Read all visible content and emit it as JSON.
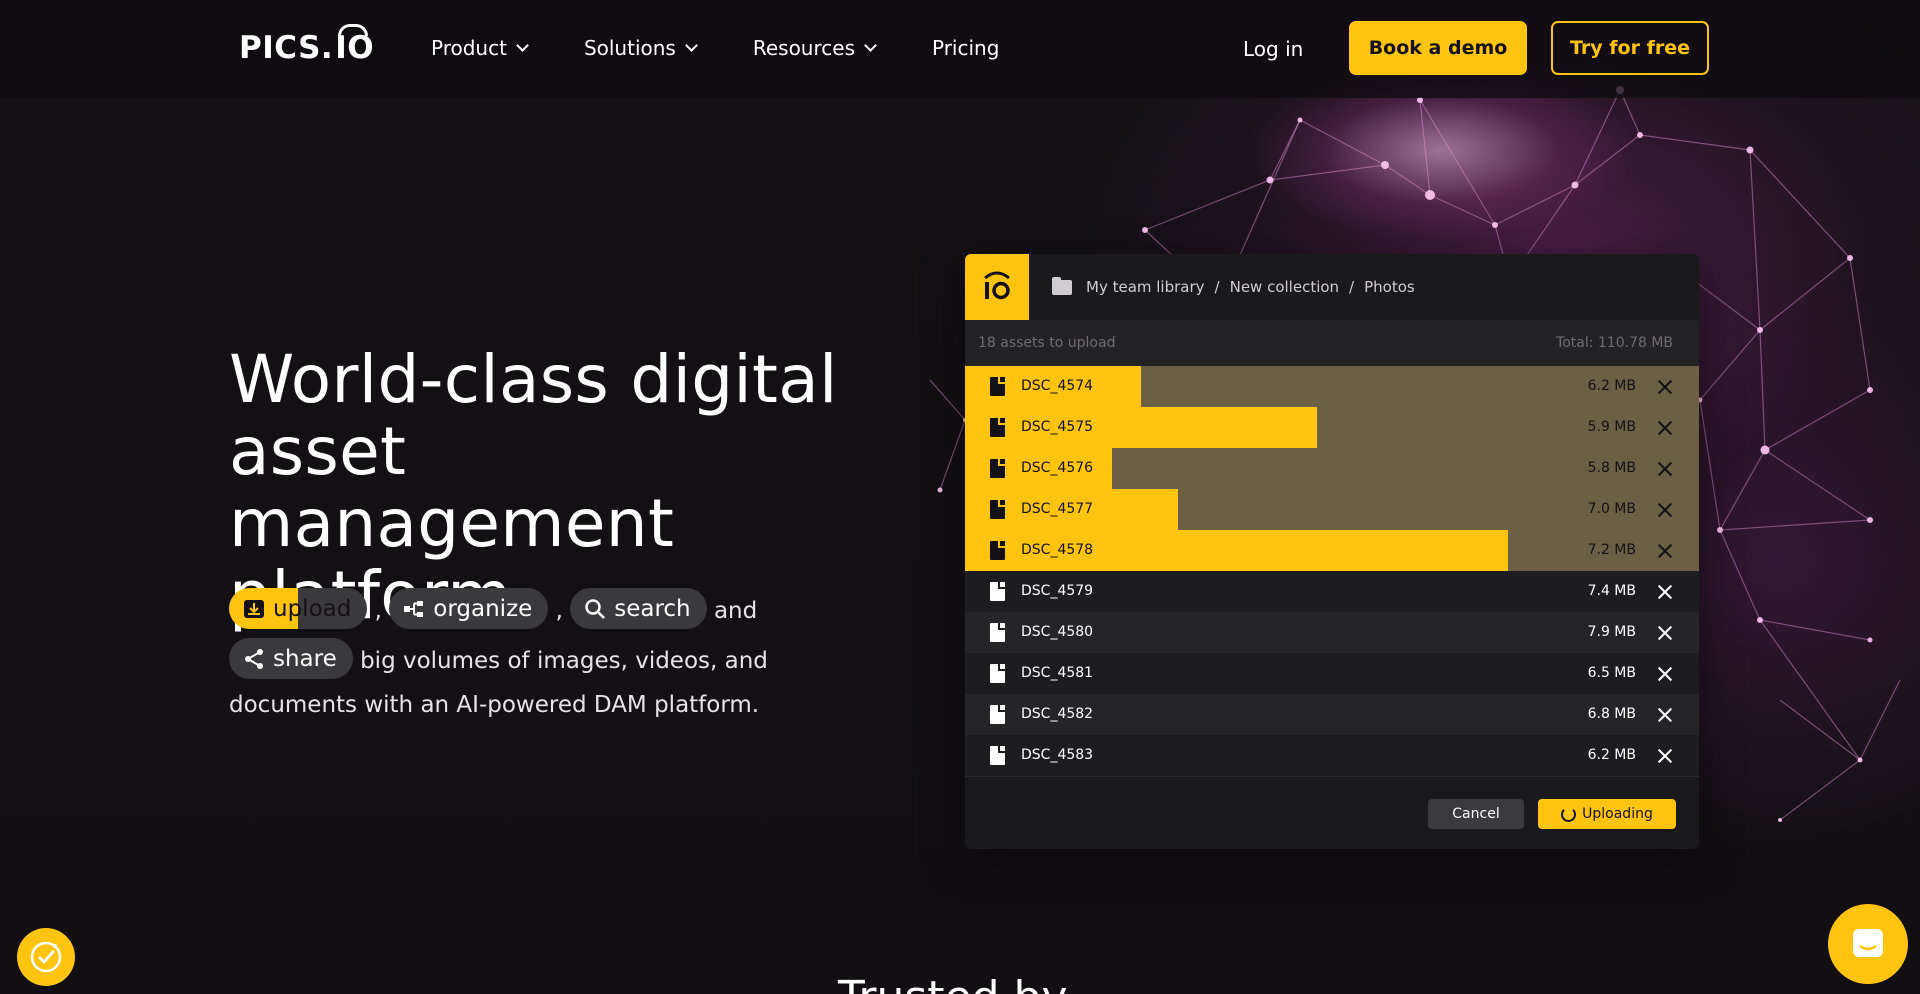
{
  "nav": {
    "logo_text": "PICS.IO",
    "logo_prefix": "PICS.",
    "logo_suffix": "IO",
    "items": [
      {
        "label": "Product",
        "has_dropdown": true
      },
      {
        "label": "Solutions",
        "has_dropdown": true
      },
      {
        "label": "Resources",
        "has_dropdown": true
      },
      {
        "label": "Pricing",
        "has_dropdown": false
      }
    ],
    "login": "Log in",
    "book_demo": "Book a demo",
    "try_free": "Try for free"
  },
  "hero": {
    "title_line1": "World-class digital",
    "title_line2": "asset management",
    "title_line3": "platform",
    "chips": {
      "upload": "upload",
      "organize": "organize",
      "search": "search",
      "share": "share"
    },
    "comma": ",",
    "and": "and",
    "sub_rest1": "big volumes of images, videos, and",
    "sub_rest2": "documents with an AI-powered DAM platform."
  },
  "dialog": {
    "breadcrumb": [
      "My team library",
      "New collection",
      "Photos"
    ],
    "separator": "/",
    "assets_count": "18 assets to upload",
    "total": "Total: 110.78 MB",
    "files": [
      {
        "name": "DSC_4574",
        "size": "6.2 MB",
        "uploading": true,
        "progress": 0.24
      },
      {
        "name": "DSC_4575",
        "size": "5.9 MB",
        "uploading": true,
        "progress": 0.48
      },
      {
        "name": "DSC_4576",
        "size": "5.8 MB",
        "uploading": true,
        "progress": 0.2
      },
      {
        "name": "DSC_4577",
        "size": "7.0 MB",
        "uploading": true,
        "progress": 0.29
      },
      {
        "name": "DSC_4578",
        "size": "7.2 MB",
        "uploading": true,
        "progress": 0.74
      },
      {
        "name": "DSC_4579",
        "size": "7.4 MB",
        "uploading": false,
        "progress": 0
      },
      {
        "name": "DSC_4580",
        "size": "7.9 MB",
        "uploading": false,
        "progress": 0
      },
      {
        "name": "DSC_4581",
        "size": "6.5 MB",
        "uploading": false,
        "progress": 0
      },
      {
        "name": "DSC_4582",
        "size": "6.8 MB",
        "uploading": false,
        "progress": 0
      },
      {
        "name": "DSC_4583",
        "size": "6.2 MB",
        "uploading": false,
        "progress": 0
      }
    ],
    "cancel": "Cancel",
    "uploading": "Uploading"
  },
  "section_peek": "Trusted by",
  "colors": {
    "accent": "#ffc40f",
    "background": "#121014",
    "upload_row_bg": "#6b5f44"
  },
  "icons": [
    "chevron-down-icon",
    "folder-icon",
    "file-icon",
    "close-icon",
    "spinner-icon",
    "cookie-icon",
    "chat-icon",
    "upload-icon",
    "organize-icon",
    "search-icon",
    "share-icon"
  ]
}
